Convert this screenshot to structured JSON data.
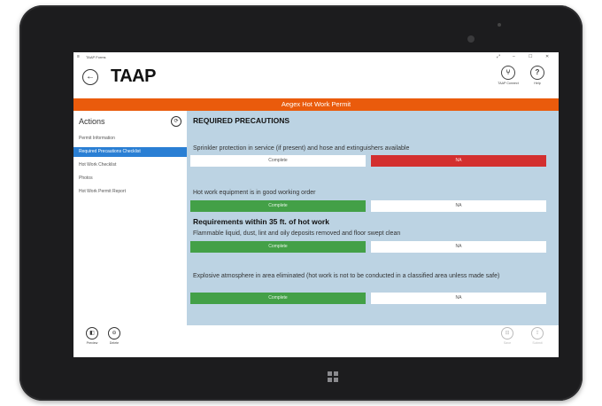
{
  "window": {
    "menu_glyph": "≡",
    "title": "TAAP Forms",
    "controls": [
      "⤢",
      "–",
      "☐",
      "✕"
    ]
  },
  "header": {
    "back_glyph": "←",
    "logo": "TAAP",
    "connect": {
      "glyph": "⑂",
      "label": "TAAP Connect"
    },
    "help": {
      "glyph": "?",
      "label": "Help"
    }
  },
  "form_title": "Aegex Hot Work Permit",
  "sidebar": {
    "title": "Actions",
    "toggle_glyph": "⟳",
    "items": [
      {
        "label": "Permit Information"
      },
      {
        "label": "Required Precautions Checklist"
      },
      {
        "label": "Hot Work Checklist"
      },
      {
        "label": "Photos"
      },
      {
        "label": "Hot Work Permit Report"
      }
    ],
    "active_index": 1
  },
  "content": {
    "section1": "REQUIRED PRECAUTIONS",
    "section2": "Requirements within 35 ft. of hot work",
    "questions": [
      {
        "text": "Sprinkler protection in service (if present) and hose and extinguishers available",
        "opt1": "Complete",
        "opt2": "NA",
        "selected": "NA"
      },
      {
        "text": "Hot work equipment is in good working order",
        "opt1": "Complete",
        "opt2": "NA",
        "selected": "Complete"
      },
      {
        "text": "Flammable liquid, dust, lint and oily deposits removed and floor swept clean",
        "opt1": "Complete",
        "opt2": "NA",
        "selected": "Complete"
      },
      {
        "text": "Explosive atmosphere in area eliminated (hot work is not to be conducted in a classified area unless made safe)",
        "opt1": "Complete",
        "opt2": "NA",
        "selected": "Complete"
      }
    ]
  },
  "footer": {
    "preview": {
      "glyph": "◧",
      "label": "Preview"
    },
    "delete": {
      "glyph": "⊖",
      "label": "Delete"
    },
    "save": {
      "glyph": "⊟",
      "label": "Save"
    },
    "submit": {
      "glyph": "⇪",
      "label": "Submit"
    }
  },
  "colors": {
    "accent_orange": "#ea5b0c",
    "selected_blue": "#2a7fd4",
    "complete_green": "#43a047",
    "na_red": "#d32f2f",
    "content_bg": "#bcd3e3"
  }
}
